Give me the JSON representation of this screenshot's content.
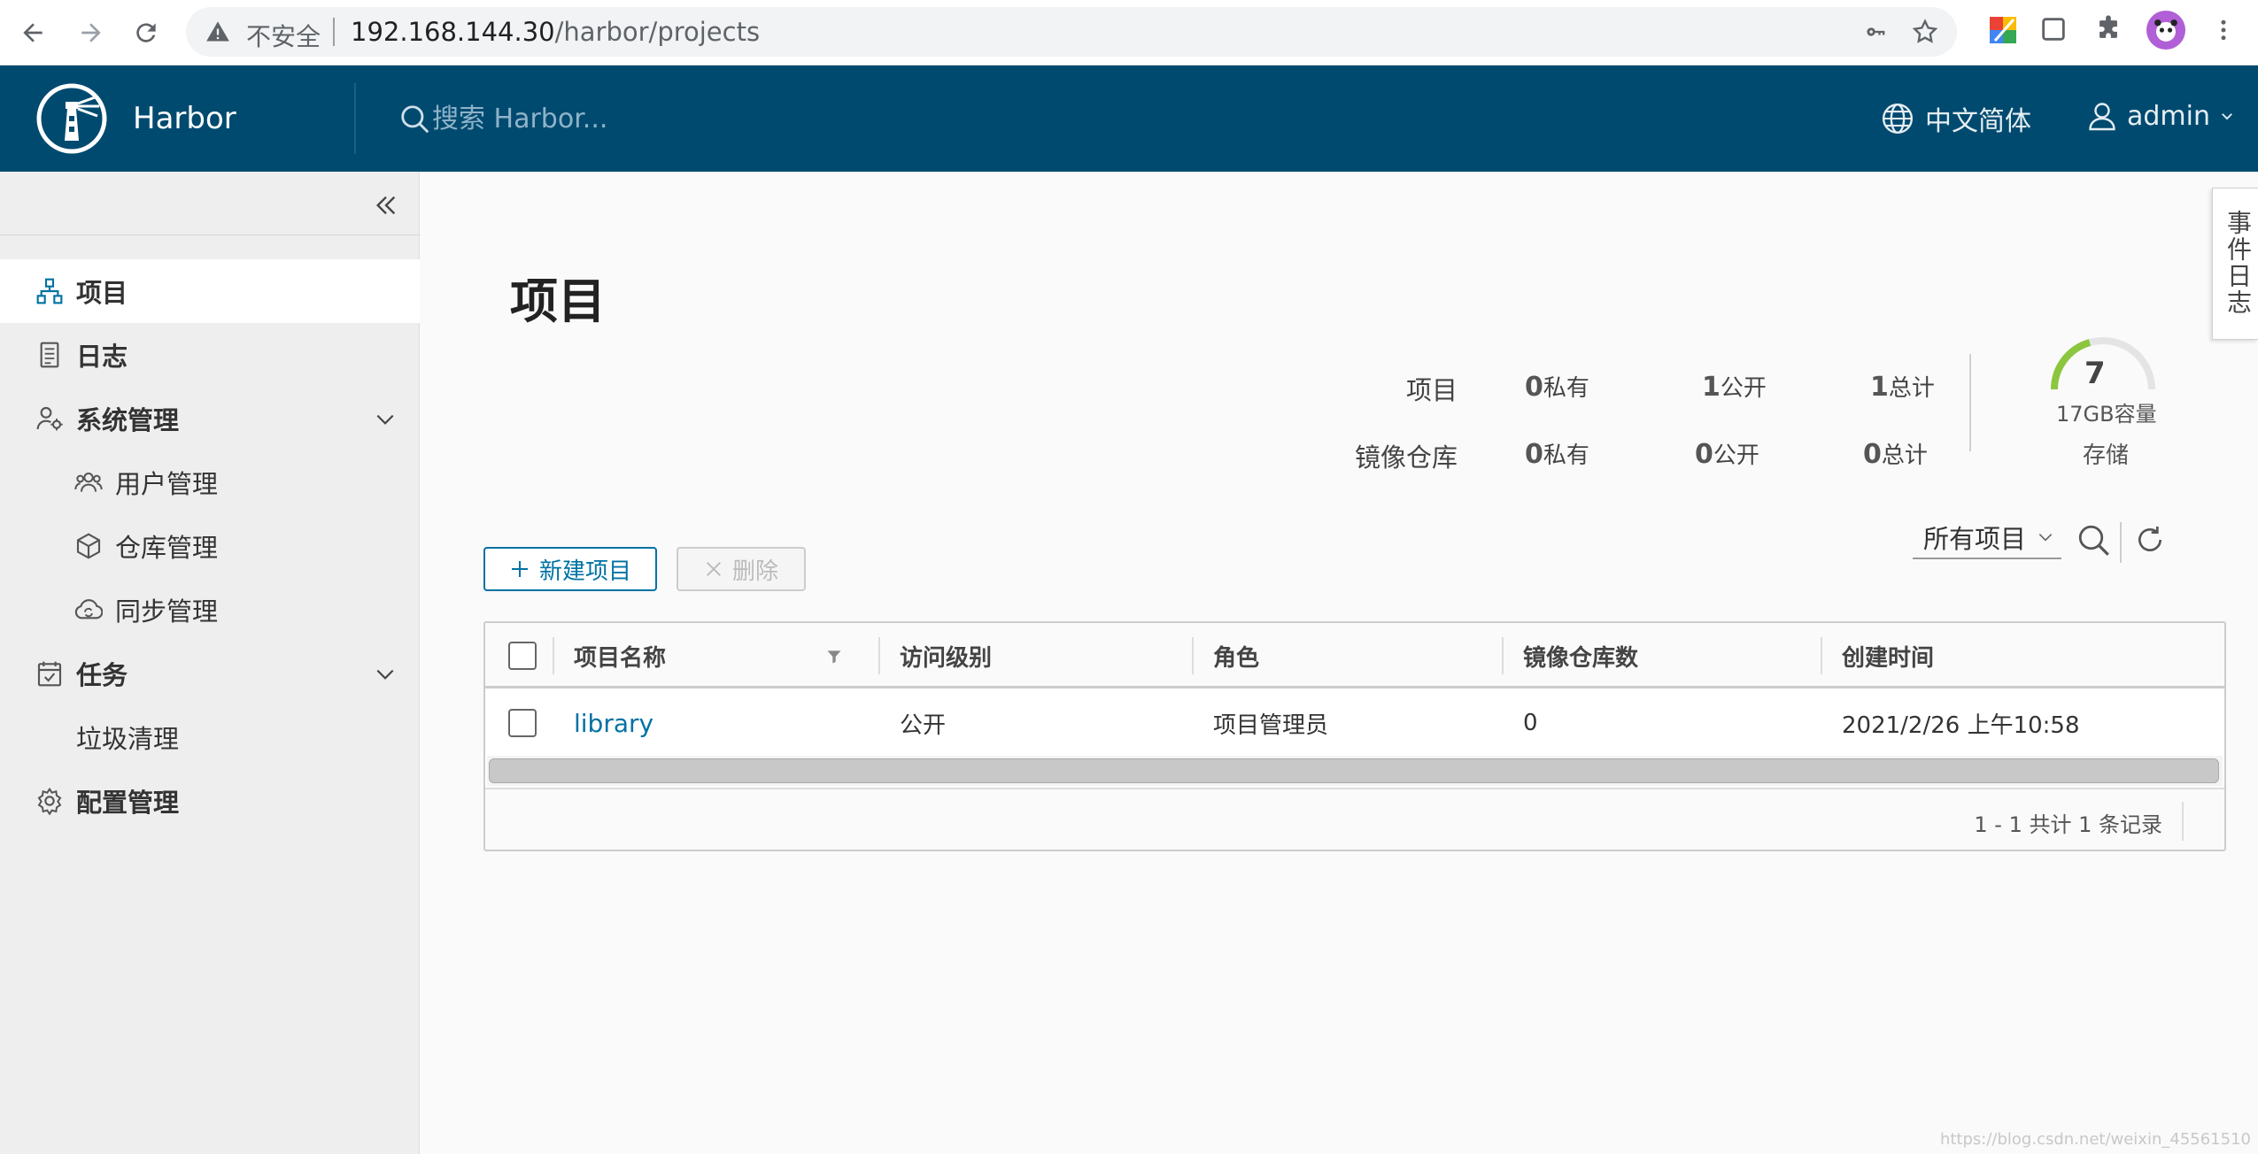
{
  "browser": {
    "security_label": "不安全",
    "url_host": "192.168.144.30",
    "url_path": "/harbor/projects"
  },
  "header": {
    "brand": "Harbor",
    "search_placeholder": "搜索 Harbor...",
    "language": "中文简体",
    "user": "admin"
  },
  "sidebar": {
    "items": [
      {
        "label": "项目",
        "icon": "projects-icon",
        "active": true
      },
      {
        "label": "日志",
        "icon": "logs-icon"
      },
      {
        "label": "系统管理",
        "icon": "admin-icon",
        "expandable": true
      },
      {
        "label": "用户管理",
        "icon": "users-icon"
      },
      {
        "label": "仓库管理",
        "icon": "registry-icon"
      },
      {
        "label": "同步管理",
        "icon": "cloud-sync-icon"
      },
      {
        "label": "任务",
        "icon": "tasks-icon",
        "expandable": true
      },
      {
        "label": "垃圾清理"
      },
      {
        "label": "配置管理",
        "icon": "gear-icon"
      }
    ]
  },
  "event_tab": "事件日志",
  "main": {
    "title": "项目",
    "summary": {
      "projects_label": "项目",
      "repos_label": "镜像仓库",
      "projects": {
        "private": "0",
        "public": "1",
        "total": "1"
      },
      "repos": {
        "private": "0",
        "public": "0",
        "total": "0"
      },
      "private_label": "私有",
      "public_label": "公开",
      "total_label": "总计",
      "storage_count": "7",
      "storage_capacity": "17GB容量",
      "storage_label": "存储"
    },
    "new_project_label": "新建项目",
    "delete_label": "删除",
    "filter_value": "所有项目"
  },
  "table": {
    "columns": [
      "项目名称",
      "访问级别",
      "角色",
      "镜像仓库数",
      "创建时间"
    ],
    "rows": [
      {
        "name": "library",
        "access": "公开",
        "role": "项目管理员",
        "repo_count": "0",
        "created": "2021/2/26 上午10:58"
      }
    ],
    "pagination": "1 - 1 共计 1 条记录"
  },
  "watermark": "https://blog.csdn.net/weixin_45561510"
}
